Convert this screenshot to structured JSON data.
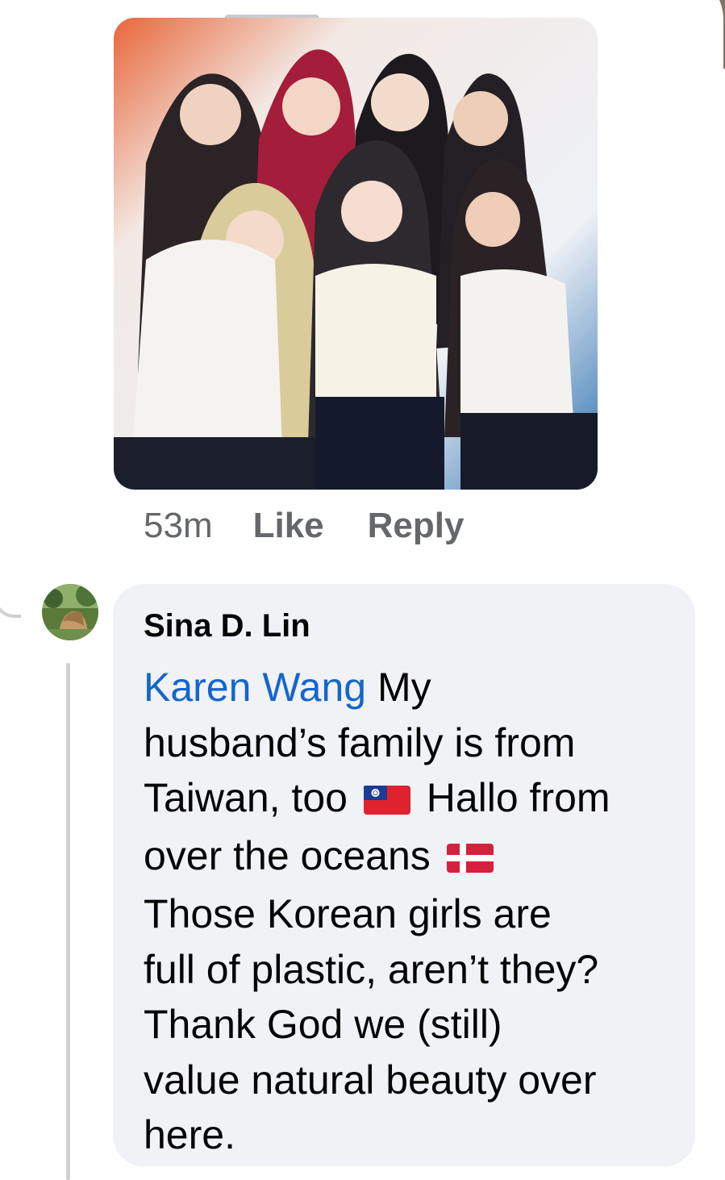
{
  "post_image": {
    "icon": "group-photo"
  },
  "comment_actions": {
    "time": "53m",
    "like_label": "Like",
    "reply_label": "Reply"
  },
  "reply_comment": {
    "author": "Sina D. Lin",
    "mention": "Karen Wang",
    "line1_rest": " My",
    "line2": "husband’s family is from",
    "line3_a": "Taiwan, too ",
    "line3_flag": "taiwan-flag-icon",
    "line3_b": " Hallo from",
    "line4_a": "over the oceans ",
    "line4_flag": "denmark-flag-icon",
    "line5": "Those Korean girls are",
    "line6": "full of plastic, aren’t they?",
    "line7": "Thank God we (still)",
    "line8": "value natural beauty over",
    "line9": "here."
  },
  "colors": {
    "link": "#1466cc",
    "secondary_text": "#65676b",
    "bubble": "#f0f2f5"
  }
}
